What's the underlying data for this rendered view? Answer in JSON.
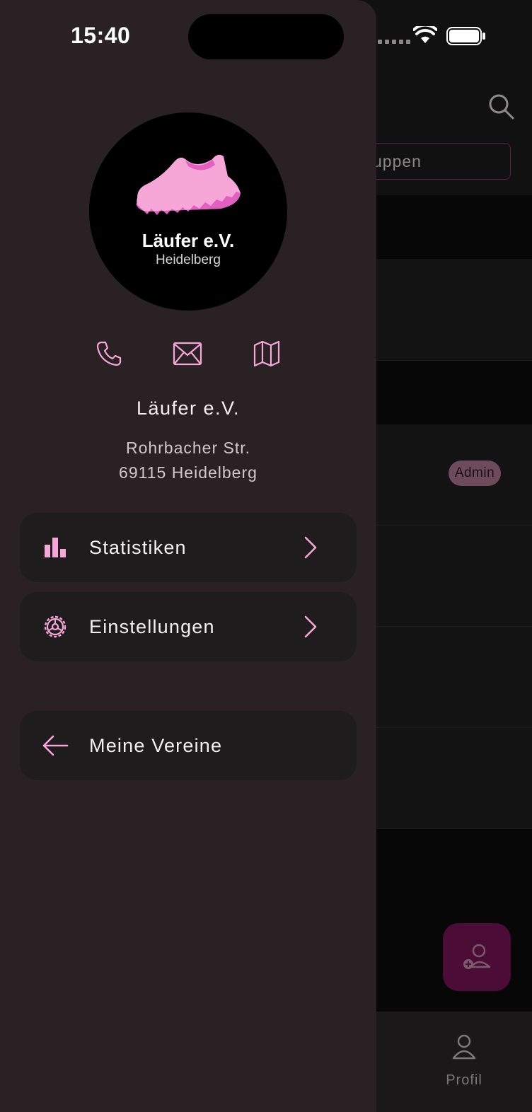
{
  "status_bar": {
    "time": "15:40"
  },
  "background": {
    "search_placeholder": "uppen",
    "admin_badge": "Admin",
    "bottom_nav": {
      "profile_label": "Profil"
    }
  },
  "drawer": {
    "logo": {
      "name": "Läufer e.V.",
      "city": "Heidelberg"
    },
    "contact_actions": [
      "phone-icon",
      "mail-icon",
      "map-icon"
    ],
    "club_name": "Läufer e.V.",
    "address_line1": "Rohrbacher Str.",
    "address_line2": "69115 Heidelberg",
    "menu": {
      "statistics": "Statistiken",
      "settings": "Einstellungen",
      "my_clubs": "Meine Vereine"
    }
  },
  "colors": {
    "accent": "#f7a6d8",
    "drawer_bg": "#2a2124",
    "card_bg": "#1f1c1e",
    "fab_bg": "#4b0d35"
  }
}
